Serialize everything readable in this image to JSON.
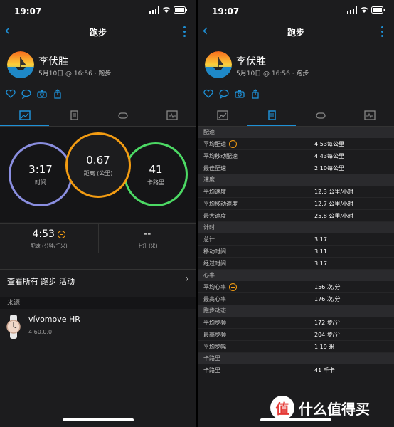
{
  "status": {
    "time": "19:07"
  },
  "nav": {
    "title": "跑步"
  },
  "profile": {
    "name": "李伏胜",
    "date": "5月10日 @ 16:56 · 跑步"
  },
  "summary": {
    "time": {
      "value": "3:17",
      "label": "时间"
    },
    "distance": {
      "value": "0.67",
      "label": "距离 (公里)"
    },
    "calories": {
      "value": "41",
      "label": "卡路里"
    },
    "pace": {
      "value": "4:53",
      "label": "配速 (分钟/千米)"
    },
    "ascent": {
      "value": "--",
      "label": "上升 (米)"
    }
  },
  "view_all": "查看所有 跑步 活动",
  "source": {
    "header": "来源",
    "device_name": "vívomove HR",
    "version": "4.60.0.0"
  },
  "details": [
    {
      "section": "配速",
      "rows": [
        {
          "k": "平均配速",
          "v": "4:53每公里",
          "icon": true
        },
        {
          "k": "平均移动配速",
          "v": "4:43每公里"
        },
        {
          "k": "最佳配速",
          "v": "2:10每公里"
        }
      ]
    },
    {
      "section": "速度",
      "rows": [
        {
          "k": "平均速度",
          "v": "12.3 公里/小时"
        },
        {
          "k": "平均移动速度",
          "v": "12.7 公里/小时"
        },
        {
          "k": "最大速度",
          "v": "25.8 公里/小时"
        }
      ]
    },
    {
      "section": "计时",
      "rows": [
        {
          "k": "总计",
          "v": "3:17"
        },
        {
          "k": "移动时间",
          "v": "3:11"
        },
        {
          "k": "经过时间",
          "v": "3:17"
        }
      ]
    },
    {
      "section": "心率",
      "rows": [
        {
          "k": "平均心率",
          "v": "156 次/分",
          "icon": true
        },
        {
          "k": "最高心率",
          "v": "176 次/分"
        }
      ]
    },
    {
      "section": "跑步动态",
      "rows": [
        {
          "k": "平均步频",
          "v": "172 步/分"
        },
        {
          "k": "最高步频",
          "v": "204 步/分"
        },
        {
          "k": "平均步幅",
          "v": "1.19 米"
        }
      ]
    },
    {
      "section": "卡路里",
      "rows": [
        {
          "k": "卡路里",
          "v": "41 千卡"
        }
      ]
    }
  ],
  "watermark": {
    "badge": "值",
    "text": "什么值得买"
  },
  "colors": {
    "accent": "#1e90d6",
    "time_ring": "#8a8ee0",
    "distance_ring": "#f39c12",
    "calories_ring": "#4cd964"
  }
}
